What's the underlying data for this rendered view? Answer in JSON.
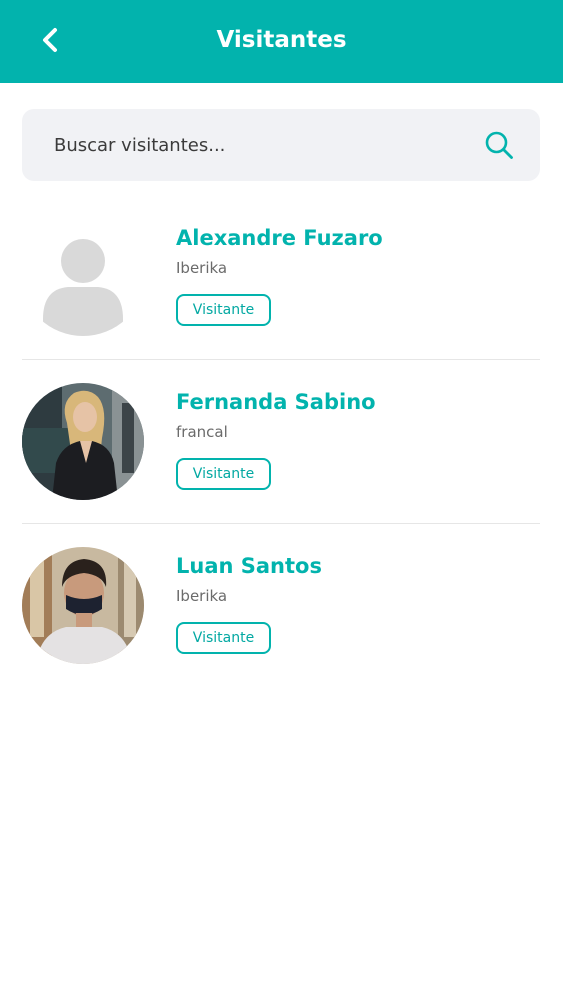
{
  "header": {
    "title": "Visitantes",
    "back_icon": "chevron-left-icon"
  },
  "search": {
    "placeholder": "Buscar visitantes...",
    "value": "",
    "icon": "search-icon"
  },
  "visitors": [
    {
      "name": "Alexandre Fuzaro",
      "company": "Iberika",
      "badge": "Visitante",
      "avatar": "default-user-icon"
    },
    {
      "name": "Fernanda Sabino",
      "company": "francal",
      "badge": "Visitante",
      "avatar": "photo"
    },
    {
      "name": "Luan Santos",
      "company": "Iberika",
      "badge": "Visitante",
      "avatar": "photo"
    }
  ],
  "colors": {
    "accent": "#02b3ad",
    "search_bg": "#f1f2f5",
    "divider": "#e6e6e6"
  }
}
